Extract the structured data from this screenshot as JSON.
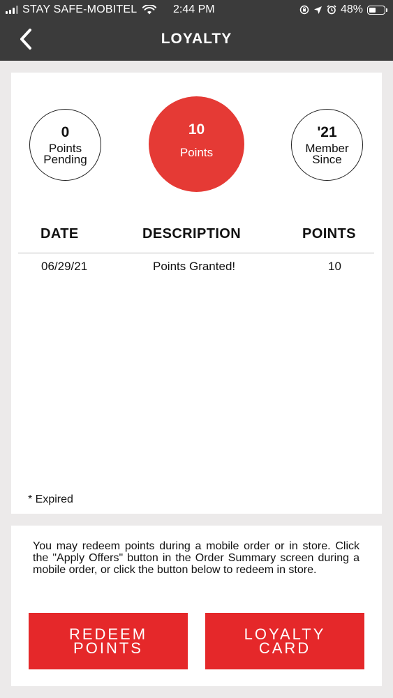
{
  "status_bar": {
    "carrier": "STAY SAFE-MOBITEL",
    "time": "2:44 PM",
    "battery": "48%",
    "battery_level": 0.48
  },
  "header": {
    "title": "LOYALTY",
    "back_icon": "chevron-left-icon"
  },
  "summary": {
    "pending": {
      "value": "0",
      "label_line1": "Points",
      "label_line2": "Pending"
    },
    "points": {
      "value": "10",
      "label": "Points",
      "color": "#e53a35"
    },
    "member": {
      "value": "'21",
      "label_line1": "Member",
      "label_line2": "Since"
    }
  },
  "table": {
    "columns": [
      "DATE",
      "DESCRIPTION",
      "POINTS"
    ],
    "rows": [
      {
        "date": "06/29/21",
        "description": "Points Granted!",
        "points": "10"
      }
    ]
  },
  "footnote": "* Expired",
  "info_text": "You may redeem points during a mobile order or in store. Click the \"Apply Offers\" button in the Order Summary screen during a mobile order, or click the button below to redeem in store.",
  "buttons": {
    "redeem": {
      "line1": "REDEEM",
      "line2": "POINTS"
    },
    "card": {
      "line1": "LOYALTY",
      "line2": "CARD"
    },
    "color": "#e5282a"
  }
}
